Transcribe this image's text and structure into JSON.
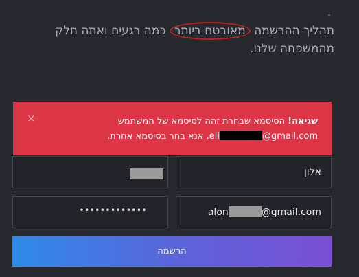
{
  "intro": {
    "part1": "תהליך ההרשמה",
    "circled": "מאובטח ביותר",
    "part2": "כמה רגעים ואתה חלק מהמשפחה שלנו."
  },
  "alert": {
    "close_glyph": "×",
    "title": "שגיאה!",
    "line1": "הסיסמא שבחרת זהה לסיסמא של המשתמש",
    "email_prefix": "eli",
    "email_domain": "@gmail.com",
    "line2": "אנא בחר בסיסמא אחרת.",
    "color": "#dc3545"
  },
  "form": {
    "first_name": "אלון",
    "email_prefix": "alon",
    "email_domain": "@gmail.com",
    "password_mask": "•••••••••••••",
    "submit_label": "הרשמה"
  },
  "colors": {
    "background": "#26292e",
    "field_background": "#222429",
    "gradient_start": "#2f8be8",
    "gradient_end": "#7a4fd3"
  }
}
